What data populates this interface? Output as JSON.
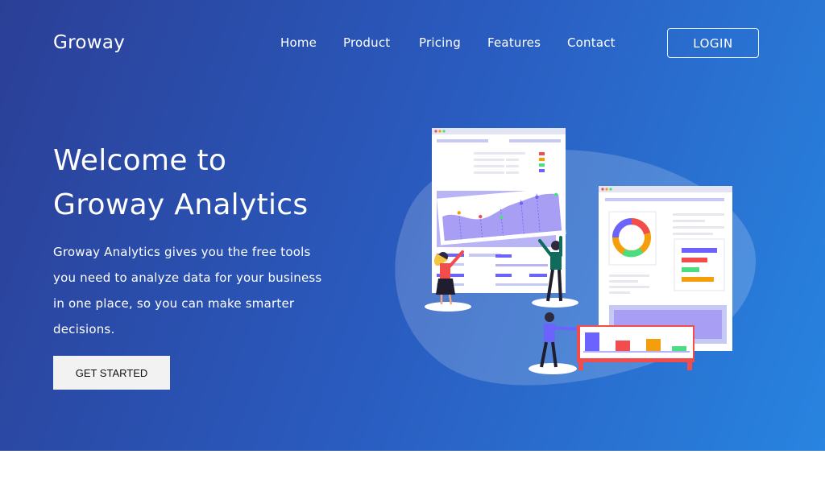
{
  "brand": {
    "name": "Groway"
  },
  "nav": {
    "items": [
      {
        "label": "Home"
      },
      {
        "label": "Product"
      },
      {
        "label": "Pricing"
      },
      {
        "label": "Features"
      },
      {
        "label": "Contact"
      }
    ],
    "login_label": "LOGIN"
  },
  "hero": {
    "title_line1": "Welcome to",
    "title_line2": "Groway Analytics",
    "description_line1": "Groway Analytics gives you the free tools",
    "description_line2": "you need to analyze data for your business",
    "description_line3": "in one place, so you can make smarter",
    "description_line4": "decisions.",
    "cta_label": "GET STARTED"
  },
  "colors": {
    "gradient_start": "#2b3f96",
    "gradient_end": "#2884e0",
    "accent_purple": "#6c63ff",
    "accent_red": "#f24c4c",
    "accent_orange": "#f59e0b",
    "accent_green": "#4ade80"
  },
  "illustration": {
    "name": "analytics-dashboard-illustration"
  }
}
